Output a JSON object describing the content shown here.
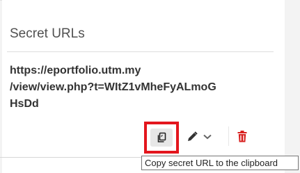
{
  "section": {
    "heading": "Secret URLs"
  },
  "secret_url": {
    "lines": [
      "https://eportfolio.utm.my",
      "/view/view.php?t=WItZ1vMheFyALmoG",
      "HsDd"
    ]
  },
  "actions": {
    "copy_icon": "clipboard-copy-icon",
    "edit_icon": "pencil-icon",
    "edit_menu_icon": "chevron-down-icon",
    "delete_icon": "trash-icon"
  },
  "tooltip": {
    "text": "Copy secret URL to the clipboard"
  },
  "colors": {
    "highlight": "#e3161d",
    "delete": "#d8201f",
    "text": "#333333"
  }
}
